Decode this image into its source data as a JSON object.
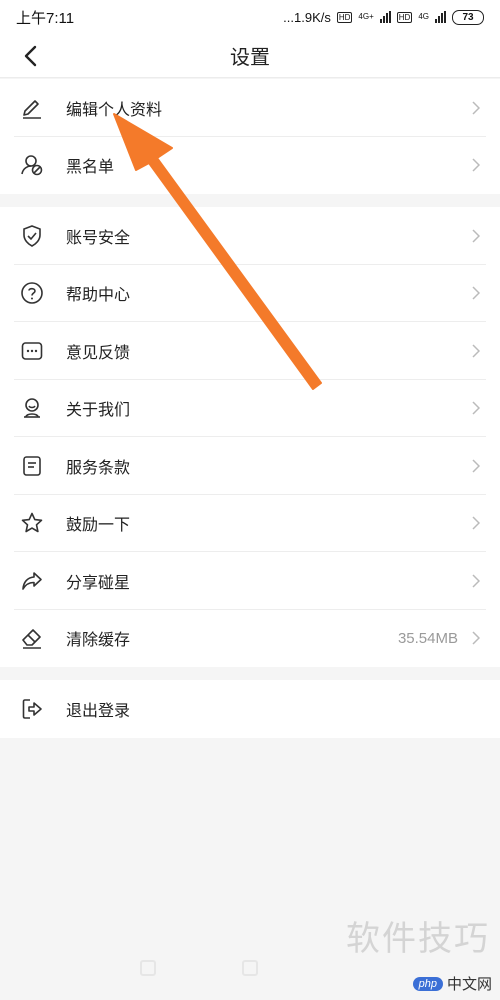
{
  "status": {
    "time": "上午7:11",
    "speed": "...1.9K/s",
    "hd1": "HD",
    "net1": "4G+",
    "hd2": "HD",
    "net2": "4G",
    "battery": "73"
  },
  "header": {
    "title": "设置"
  },
  "group1": [
    {
      "label": "编辑个人资料",
      "icon": "edit-icon"
    },
    {
      "label": "黑名单",
      "icon": "blacklist-icon"
    }
  ],
  "group2": [
    {
      "label": "账号安全",
      "icon": "shield-icon"
    },
    {
      "label": "帮助中心",
      "icon": "question-icon"
    },
    {
      "label": "意见反馈",
      "icon": "feedback-icon"
    },
    {
      "label": "关于我们",
      "icon": "about-icon"
    },
    {
      "label": "服务条款",
      "icon": "document-icon"
    },
    {
      "label": "鼓励一下",
      "icon": "star-icon"
    },
    {
      "label": "分享碰星",
      "icon": "share-icon"
    },
    {
      "label": "清除缓存",
      "icon": "eraser-icon",
      "value": "35.54MB"
    }
  ],
  "group3": [
    {
      "label": "退出登录",
      "icon": "logout-icon"
    }
  ],
  "watermark": {
    "text": "软件技巧",
    "php": "php",
    "site": "中文网"
  },
  "colors": {
    "arrow": "#f47a2a",
    "background": "#f5f5f5",
    "row_bg": "#ffffff"
  }
}
